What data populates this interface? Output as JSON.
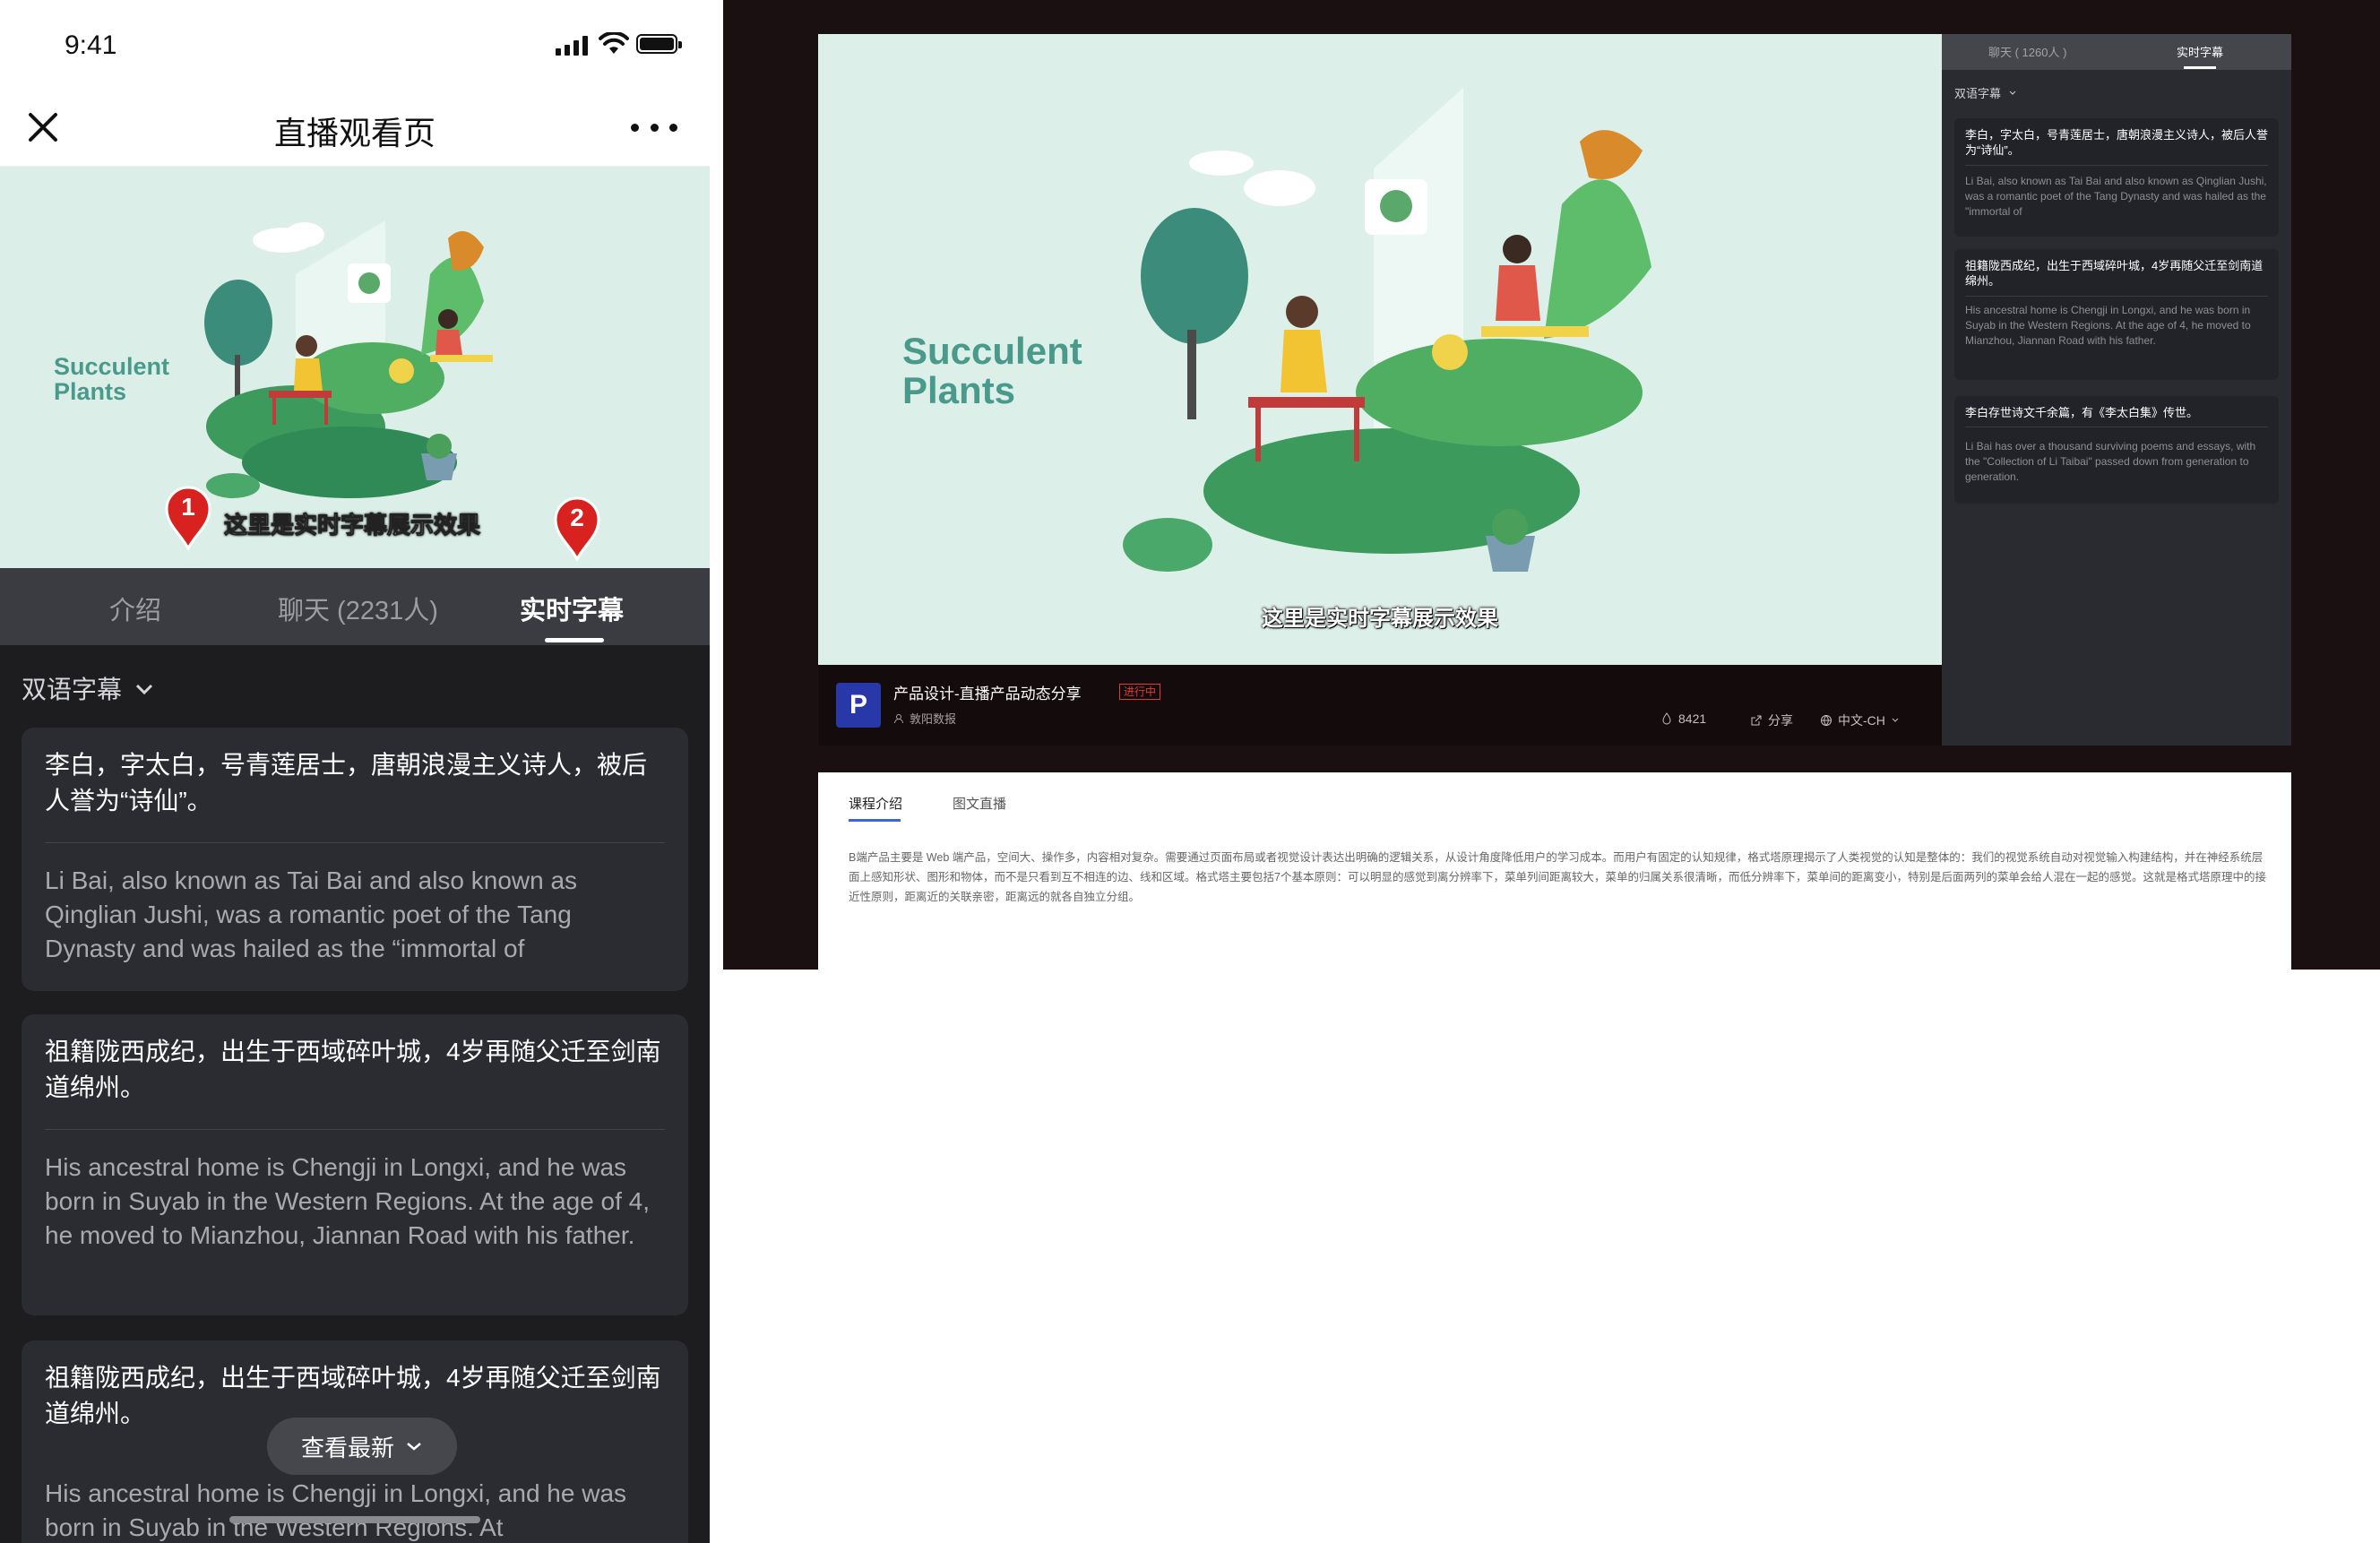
{
  "mobile": {
    "status": {
      "time": "9:41"
    },
    "nav": {
      "title": "直播观看页"
    },
    "video": {
      "brand_line1": "Succulent",
      "brand_line2": "Plants",
      "subtitle": "这里是实时字幕展示效果"
    },
    "markers": [
      "1",
      "2"
    ],
    "tabs": [
      {
        "label": "介绍"
      },
      {
        "label": "聊天 (2231人)"
      },
      {
        "label": "实时字幕"
      }
    ],
    "lang_select": "双语字幕",
    "cards": [
      {
        "zh": "李白，字太白，号青莲居士，唐朝浪漫主义诗人，被后人誉为“诗仙”。",
        "en": "Li Bai, also known as Tai Bai and also known as Qinglian Jushi, was a romantic poet of the Tang Dynasty and was hailed as the “immortal of"
      },
      {
        "zh": "祖籍陇西成纪，出生于西域碎叶城，4岁再随父迁至剑南道绵州。",
        "en": "His ancestral home is Chengji in Longxi, and he was born in Suyab in the Western Regions. At the age of 4, he moved to Mianzhou, Jiannan Road with his father."
      },
      {
        "zh": "祖籍陇西成纪，出生于西域碎叶城，4岁再随父迁至剑南道绵州。",
        "en": "His ancestral home is Chengji in Longxi, and he was born in Suyab in the Western Regions. At"
      }
    ],
    "see_latest": "查看最新"
  },
  "desktop": {
    "video": {
      "brand_line1": "Succulent",
      "brand_line2": "Plants",
      "subtitle": "这里是实时字幕展示效果"
    },
    "info": {
      "logo": "P",
      "title": "产品设计-直播产品动态分享",
      "live_badge": "进行中",
      "host": "敦阳数报",
      "likes": "8421",
      "share": "分享",
      "language": "中文-CH"
    },
    "side": {
      "tabs": [
        {
          "label": "聊天 ( 1260人 )"
        },
        {
          "label": "实时字幕"
        }
      ],
      "lang_select": "双语字幕",
      "cards": [
        {
          "zh": "李白，字太白，号青莲居士，唐朝浪漫主义诗人，被后人誉为“诗仙”。",
          "en": "Li Bai, also known as Tai Bai and also known as Qinglian Jushi, was a romantic poet of the Tang Dynasty and was hailed as the \"immortal of"
        },
        {
          "zh": "祖籍陇西成纪，出生于西域碎叶城，4岁再随父迁至剑南道绵州。",
          "en": "His ancestral home is Chengji in Longxi, and he was born in Suyab in the Western Regions. At the age of 4, he moved to Mianzhou, Jiannan Road with his father."
        },
        {
          "zh": "李白存世诗文千余篇，有《李太白集》传世。",
          "en": "Li Bai has over a thousand surviving poems and essays, with the \"Collection of Li Taibai\" passed down from generation to generation."
        }
      ]
    },
    "bottom": {
      "tabs": [
        {
          "label": "课程介绍"
        },
        {
          "label": "图文直播"
        }
      ],
      "description": "B端产品主要是 Web 端产品，空间大、操作多，内容相对复杂。需要通过页面布局或者视觉设计表达出明确的逻辑关系，从设计角度降低用户的学习成本。而用户有固定的认知规律，格式塔原理揭示了人类视觉的认知是整体的：我们的视觉系统自动对视觉输入构建结构，并在神经系统层面上感知形状、图形和物体，而不是只看到互不相连的边、线和区域。格式塔主要包括7个基本原则：可以明显的感觉到离分辨率下，菜单列间距离较大，菜单的归属关系很清晰，而低分辨率下，菜单间的距离变小，特别是后面两列的菜单会给人混在一起的感觉。这就是格式塔原理中的接近性原则，距离近的关联亲密，距离远的就各自独立分组。"
    }
  }
}
